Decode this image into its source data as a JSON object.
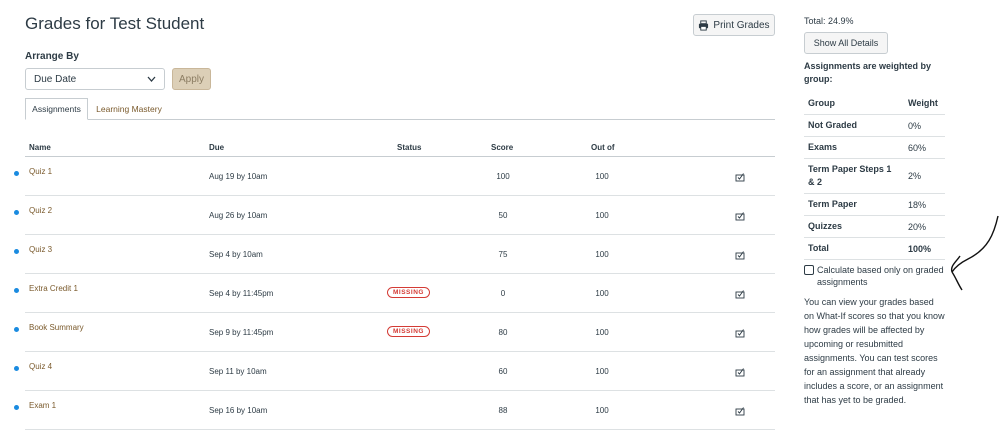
{
  "page": {
    "title": "Grades for Test Student"
  },
  "toolbar": {
    "print_label": "Print Grades"
  },
  "arrange": {
    "label": "Arrange By",
    "selected": "Due Date",
    "apply_label": "Apply"
  },
  "tabs": [
    {
      "label": "Assignments"
    },
    {
      "label": "Learning Mastery"
    }
  ],
  "table": {
    "headers": {
      "name": "Name",
      "due": "Due",
      "status": "Status",
      "score": "Score",
      "out_of": "Out of"
    },
    "rows": [
      {
        "name": "Quiz 1",
        "due": "Aug 19 by 10am",
        "status": "",
        "score": "100",
        "out_of": "100"
      },
      {
        "name": "Quiz 2",
        "due": "Aug 26 by 10am",
        "status": "",
        "score": "50",
        "out_of": "100"
      },
      {
        "name": "Quiz 3",
        "due": "Sep 4 by 10am",
        "status": "",
        "score": "75",
        "out_of": "100"
      },
      {
        "name": "Extra Credit 1",
        "due": "Sep 4 by 11:45pm",
        "status": "MISSING",
        "score": "0",
        "out_of": "100"
      },
      {
        "name": "Book Summary",
        "due": "Sep 9 by 11:45pm",
        "status": "MISSING",
        "score": "80",
        "out_of": "100"
      },
      {
        "name": "Quiz 4",
        "due": "Sep 11 by 10am",
        "status": "",
        "score": "60",
        "out_of": "100"
      },
      {
        "name": "Exam 1",
        "due": "Sep 16 by 10am",
        "status": "",
        "score": "88",
        "out_of": "100"
      }
    ]
  },
  "sidebar": {
    "total": "Total: 24.9%",
    "show_details_label": "Show All Details",
    "weighted_heading": "Assignments are weighted by group:",
    "weights_header": {
      "group": "Group",
      "weight": "Weight"
    },
    "weights": [
      {
        "group": "Not Graded",
        "weight": "0%"
      },
      {
        "group": "Exams",
        "weight": "60%"
      },
      {
        "group": "Term Paper Steps 1 & 2",
        "weight": "2%"
      },
      {
        "group": "Term Paper",
        "weight": "18%"
      },
      {
        "group": "Quizzes",
        "weight": "20%"
      },
      {
        "group": "Total",
        "weight": "100%"
      }
    ],
    "calc_label": "Calculate based only on graded assignments",
    "info_text": "You can view your grades based on What-If scores so that you know how grades will be affected by upcoming or resubmitted assignments. You can test scores for an assignment that already includes a score, or an assignment that has yet to be graded."
  },
  "colors": {
    "accent_link": "#7a5a2c",
    "missing": "#d43b35",
    "dot": "#1a8be0",
    "apply_bg": "#dccfb7"
  }
}
